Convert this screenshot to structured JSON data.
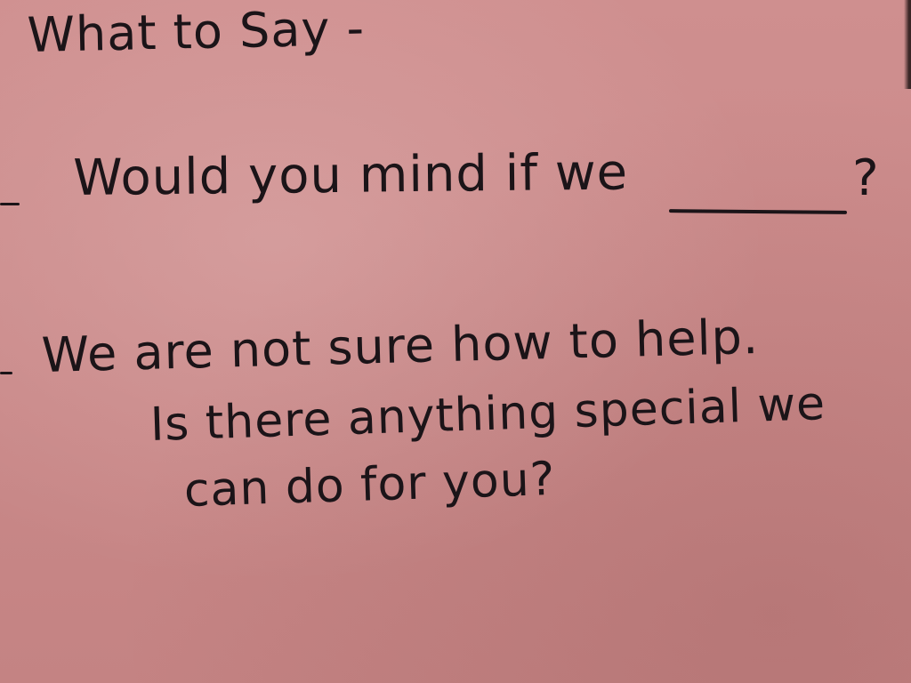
{
  "sign": {
    "title": "What to Say -",
    "line1": "Would you mind if we",
    "line1_end": "?",
    "line2": "We are not sure how to help.",
    "line3": "Is there anything special we",
    "line4": "can do for you?"
  },
  "colors": {
    "paper": "#c98a8a",
    "ink": "#1b1418"
  }
}
